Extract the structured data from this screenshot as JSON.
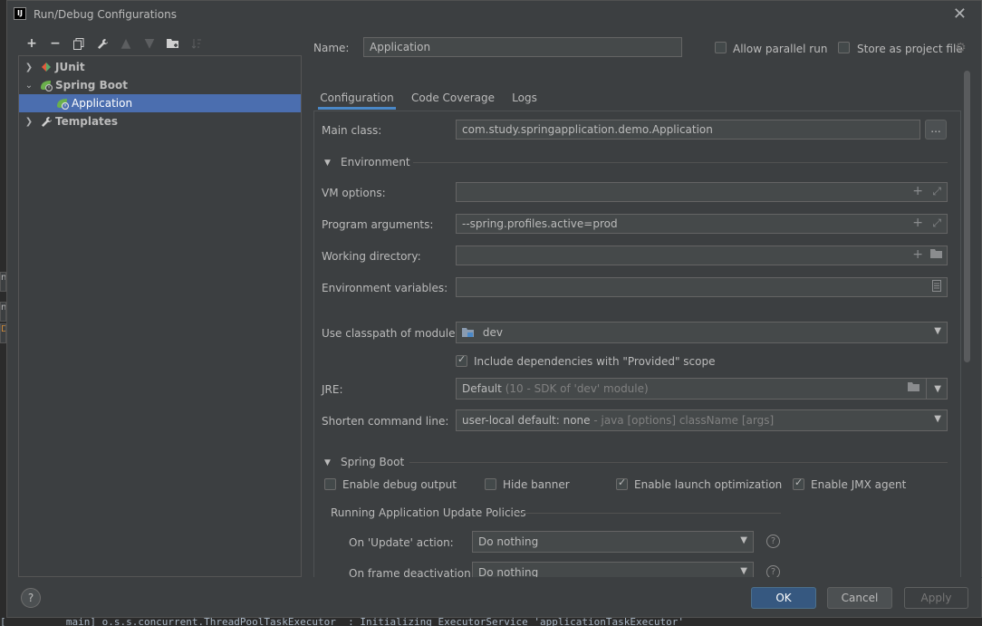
{
  "window": {
    "title": "Run/Debug Configurations"
  },
  "background": {
    "tabs": [
      "n",
      "n",
      "D"
    ],
    "log_text": "[          main] o.s.s.concurrent.ThreadPoolTaskExecutor  : Initializing ExecutorService 'applicationTaskExecutor'"
  },
  "tree": {
    "items": [
      {
        "label": "JUnit",
        "icon": "junit-icon",
        "expanded": false
      },
      {
        "label": "Spring Boot",
        "icon": "spring-boot-icon",
        "expanded": true
      },
      {
        "label": "Application",
        "icon": "spring-boot-app-icon",
        "selected": true
      },
      {
        "label": "Templates",
        "icon": "wrench-icon",
        "expanded": false
      }
    ]
  },
  "header": {
    "name_label": "Name:",
    "name_value": "Application",
    "allow_parallel_label": "Allow parallel run",
    "allow_parallel_checked": false,
    "store_project_label": "Store as project file",
    "store_project_checked": false
  },
  "tabs": [
    {
      "label": "Configuration",
      "active": true
    },
    {
      "label": "Code Coverage",
      "active": false
    },
    {
      "label": "Logs",
      "active": false
    }
  ],
  "config": {
    "main_class_label": "Main class:",
    "main_class_value": "com.study.springapplication.demo.Application",
    "browse_label": "...",
    "environment_label": "Environment",
    "vm_options_label": "VM options:",
    "vm_options_value": "",
    "program_args_label": "Program arguments:",
    "program_args_value": "--spring.profiles.active=prod",
    "working_dir_label": "Working directory:",
    "working_dir_value": "",
    "env_vars_label": "Environment variables:",
    "env_vars_value": "",
    "classpath_label": "Use classpath of module:",
    "classpath_value": "dev",
    "include_deps_label": "Include dependencies with \"Provided\" scope",
    "include_deps_checked": true,
    "jre_label": "JRE:",
    "jre_value": "Default",
    "jre_hint": "(10 - SDK of 'dev' module)",
    "shorten_label": "Shorten command line:",
    "shorten_value": "user-local default: none",
    "shorten_hint": " - java [options] className [args]"
  },
  "spring_boot": {
    "section_label": "Spring Boot",
    "debug_output_label": "Enable debug output",
    "debug_output_checked": false,
    "hide_banner_label": "Hide banner",
    "hide_banner_checked": false,
    "launch_opt_label": "Enable launch optimization",
    "launch_opt_checked": true,
    "jmx_label": "Enable JMX agent",
    "jmx_checked": true,
    "policies_label": "Running Application Update Policies",
    "update_action_label": "On 'Update' action:",
    "update_action_value": "Do nothing",
    "frame_deactivation_label": "On frame deactivation:",
    "frame_deactivation_value": "Do nothing"
  },
  "footer": {
    "help_label": "?",
    "ok_label": "OK",
    "cancel_label": "Cancel",
    "apply_label": "Apply"
  },
  "colors": {
    "selection": "#4b6eaf",
    "accent": "#365880",
    "tab_underline": "#4a88c7"
  }
}
